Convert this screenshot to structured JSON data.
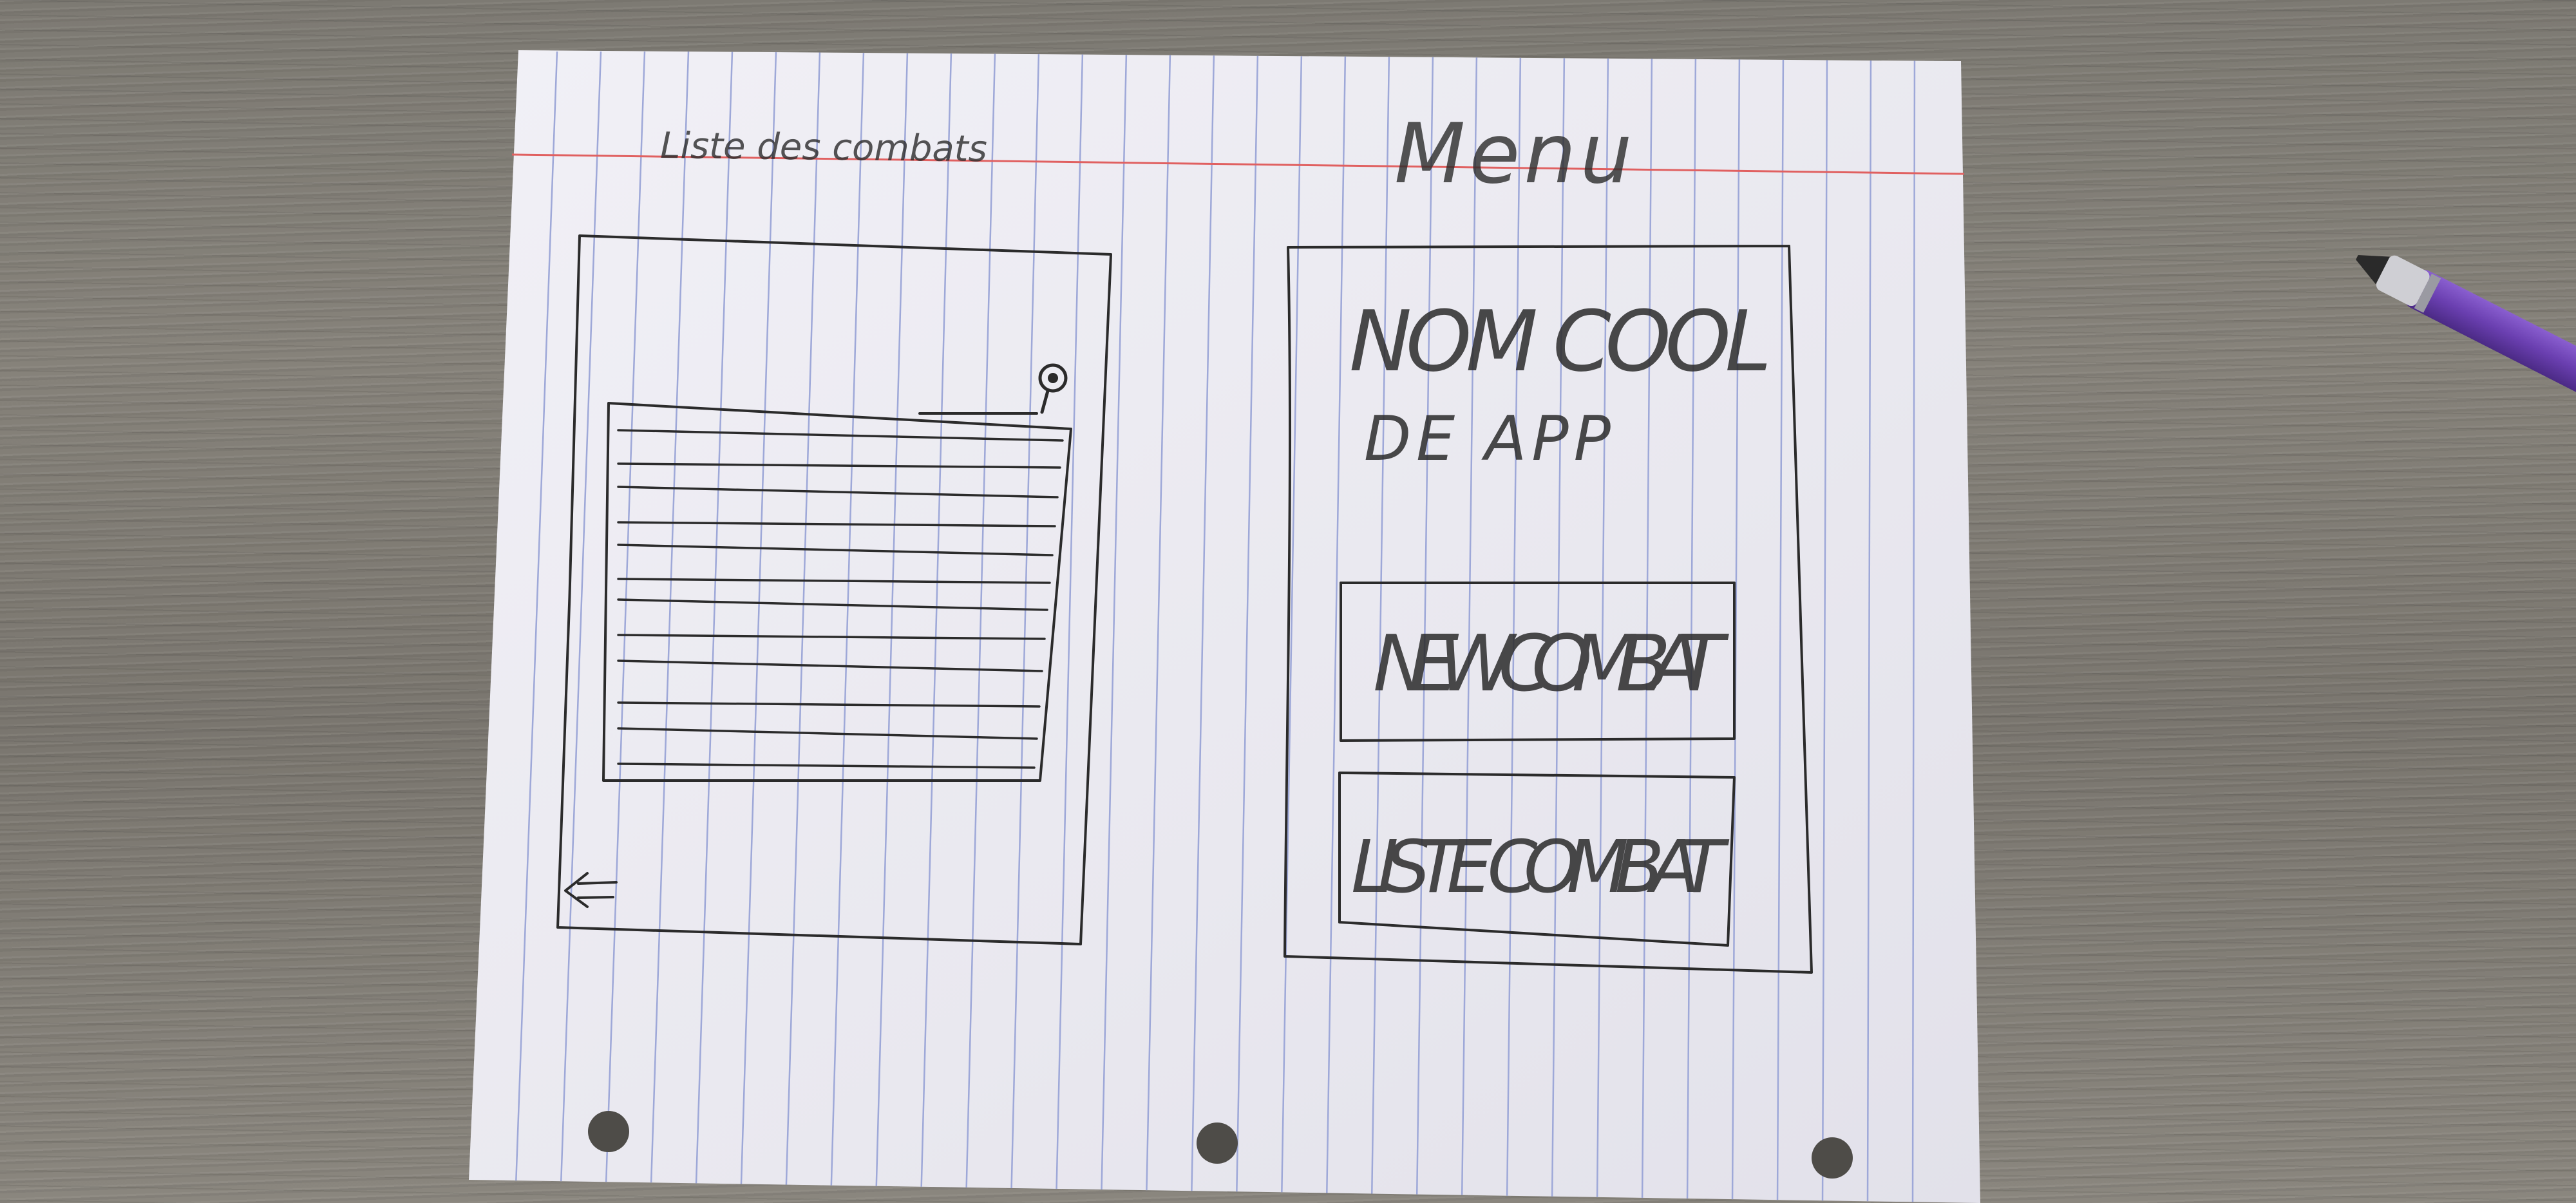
{
  "left_screen": {
    "title": "Liste des combats",
    "back_icon": "back-arrow-icon",
    "search_icon": "search-icon"
  },
  "right_screen": {
    "title": "Menu",
    "app_name_line1": "NOM COOL",
    "app_name_line2": "DE APP",
    "new_combat_label": "NEW COMBAT",
    "liste_combat_label": "LISTE COMBAT"
  },
  "colors": {
    "paper": "#eeedf3",
    "ruled_line": "#9ea8d8",
    "margin_line": "#e06060",
    "pencil": "#2b2b2b",
    "desk": "#807c74",
    "pen_body": "#6a3fb0"
  }
}
